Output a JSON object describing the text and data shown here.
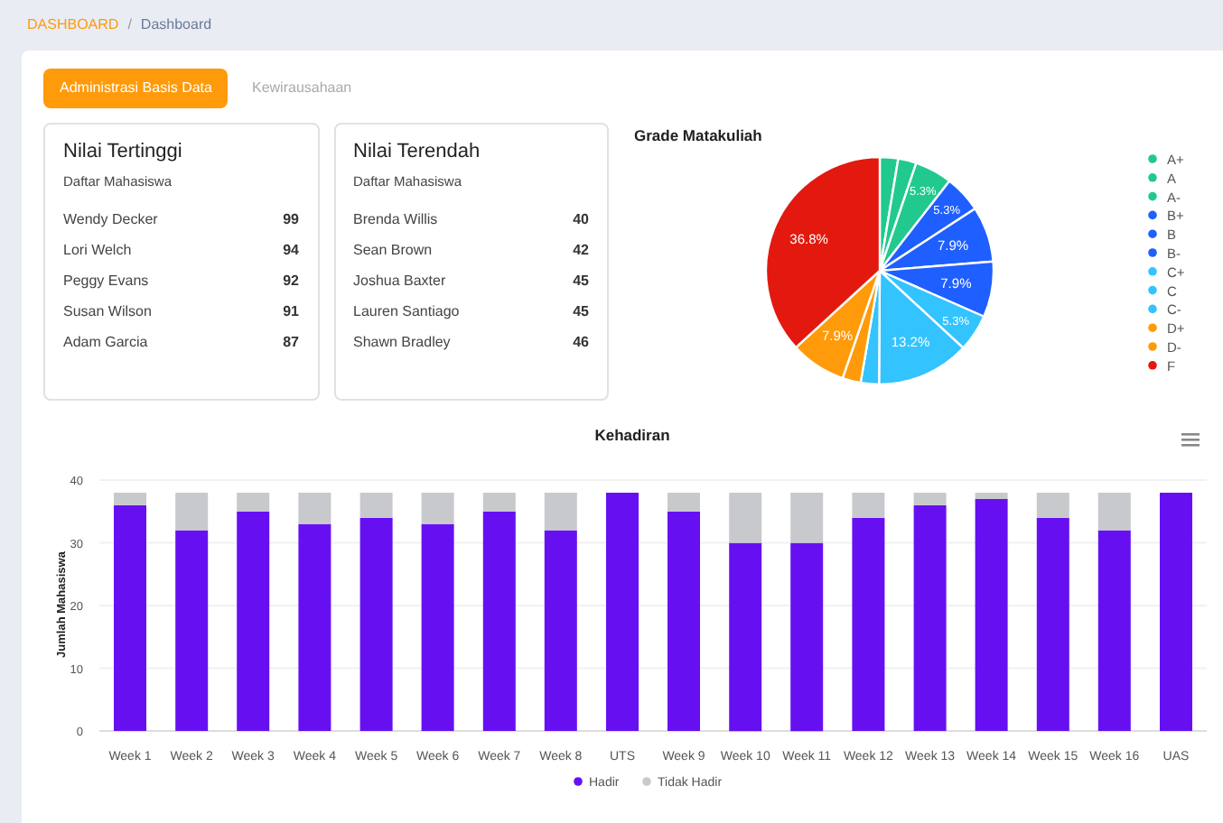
{
  "breadcrumb": [
    {
      "label": "DASHBOARD",
      "active": false
    },
    {
      "label": "Dashboard",
      "active": true
    }
  ],
  "breadcrumb_separator": "/",
  "tabs": [
    {
      "label": "Administrasi Basis Data",
      "selected": true
    },
    {
      "label": "Kewirausahaan",
      "selected": false
    }
  ],
  "lists": [
    {
      "title": "Nilai Tertinggi",
      "subtitle": "Daftar Mahasiswa",
      "rows": [
        {
          "name": "Wendy Decker",
          "score": "99"
        },
        {
          "name": "Lori Welch",
          "score": "94"
        },
        {
          "name": "Peggy Evans",
          "score": "92"
        },
        {
          "name": "Susan Wilson",
          "score": "91"
        },
        {
          "name": "Adam Garcia",
          "score": "87"
        }
      ]
    },
    {
      "title": "Nilai Terendah",
      "subtitle": "Daftar Mahasiswa",
      "rows": [
        {
          "name": "Brenda Willis",
          "score": "40"
        },
        {
          "name": "Sean Brown",
          "score": "42"
        },
        {
          "name": "Joshua Baxter",
          "score": "45"
        },
        {
          "name": "Lauren Santiago",
          "score": "45"
        },
        {
          "name": "Shawn Bradley",
          "score": "46"
        }
      ]
    }
  ],
  "grade_chart": {
    "chart_data": {
      "type": "pie",
      "title": "Grade Matakuliah",
      "categories": [
        "A+",
        "A",
        "A-",
        "B+",
        "B",
        "B-",
        "C+",
        "C",
        "C-",
        "D+",
        "D-",
        "F"
      ],
      "legend": true,
      "series": [
        {
          "colors": [
            "#22c98e",
            "#22c98e",
            "#22c98e",
            "#1f5fff",
            "#1f5fff",
            "#1f5fff",
            "#33c3ff",
            "#33c3ff",
            "#33c3ff",
            "#ff9a0a",
            "#ff9a0a",
            "#e3190f"
          ],
          "values": [
            2.6,
            2.6,
            5.3,
            5.3,
            7.9,
            7.9,
            5.3,
            13.2,
            2.6,
            2.6,
            7.9,
            36.8
          ]
        }
      ],
      "value_labels": [
        null,
        null,
        "5.3%",
        "5.3%",
        "7.9%",
        "7.9%",
        "5.3%",
        "13.2%",
        null,
        null,
        "7.9%",
        "36.8%"
      ]
    }
  },
  "attendance_chart": {
    "chart_data": {
      "type": "bar",
      "title": "Kehadiran",
      "ylabel": "Jumlah Mahasiswa",
      "stacked": true,
      "grid": true,
      "legend": true,
      "ylim": [
        0,
        40
      ],
      "yticks": [
        {
          "value": 0,
          "label": "0"
        },
        {
          "value": 10,
          "label": "10"
        },
        {
          "value": 20,
          "label": "20"
        },
        {
          "value": 30,
          "label": "30"
        },
        {
          "value": 40,
          "label": "40"
        }
      ],
      "categories": [
        "Week 1",
        "Week 2",
        "Week 3",
        "Week 4",
        "Week 5",
        "Week 6",
        "Week 7",
        "Week 8",
        "UTS",
        "Week 9",
        "Week 10",
        "Week 11",
        "Week 12",
        "Week 13",
        "Week 14",
        "Week 15",
        "Week 16",
        "UAS"
      ],
      "series": [
        {
          "name": "Hadir",
          "color": "#6610f2",
          "values": [
            36,
            32,
            35,
            33,
            34,
            33,
            35,
            32,
            38,
            35,
            30,
            30,
            34,
            36,
            37,
            34,
            32,
            38
          ]
        },
        {
          "name": "Tidak Hadir",
          "color": "#c8c9cc",
          "values": [
            2,
            6,
            3,
            5,
            4,
            5,
            3,
            6,
            0,
            3,
            8,
            8,
            4,
            2,
            1,
            4,
            6,
            0
          ]
        }
      ]
    }
  }
}
